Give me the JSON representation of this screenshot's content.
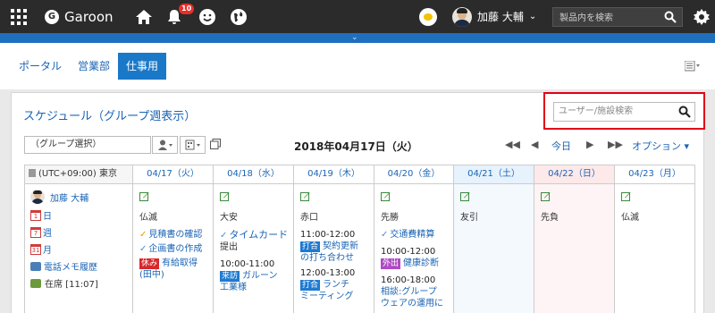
{
  "header": {
    "app_name": "Garoon",
    "logo_letter": "G",
    "notification_count": "10",
    "user_name": "加藤 大輔",
    "search_placeholder": "製品内を検索"
  },
  "tabs": [
    "ポータル",
    "営業部",
    "仕事用"
  ],
  "schedule": {
    "title": "スケジュール（グループ週表示）",
    "facility_search_placeholder": "ユーザー/施設検索",
    "group_select": "（グループ選択）",
    "current_date": "2018年04月17日（火）",
    "today_label": "今日",
    "option_label": "オプション",
    "timezone": "(UTC+09:00) 東京",
    "days": [
      {
        "label": "04/17（火）",
        "rokuyo": "仏滅"
      },
      {
        "label": "04/18（水）",
        "rokuyo": "大安"
      },
      {
        "label": "04/19（木）",
        "rokuyo": "赤口"
      },
      {
        "label": "04/20（金）",
        "rokuyo": "先勝"
      },
      {
        "label": "04/21（土）",
        "rokuyo": "友引"
      },
      {
        "label": "04/22（日）",
        "rokuyo": "先負"
      },
      {
        "label": "04/23（月）",
        "rokuyo": "仏滅"
      }
    ],
    "user": {
      "name": "加藤 大輔",
      "day_link": "日",
      "week_link": "週",
      "month_link": "月",
      "memo_link": "電話メモ履歴",
      "presence": "在席 [11:07]"
    },
    "events": {
      "d0": [
        "見積書の確認",
        "企画書の作成",
        "有給取得",
        "(田中)"
      ],
      "d0_tag": "休み",
      "d1_todo": "タイムカード",
      "d1_todo2": "提出",
      "d1_time": "10:00-11:00",
      "d1_tag": "来訪",
      "d1_event": "ガルーン",
      "d1_event2": "工業様",
      "d2_time1": "11:00-12:00",
      "d2_tag1": "打合",
      "d2_event1": "契約更新",
      "d2_event1b": "の打ち合わせ",
      "d2_time2": "12:00-13:00",
      "d2_tag2": "打合",
      "d2_event2": "ランチ",
      "d2_event2b": "ミーティング",
      "d3_todo": "交通費精算",
      "d3_time1": "10:00-12:00",
      "d3_tag1": "外出",
      "d3_event1": "健康診断",
      "d3_time2": "16:00-18:00",
      "d3_event2": "相談:グループ",
      "d3_event2b": "ウェアの運用に"
    }
  },
  "colors": {
    "topbar": "#2b2b2b",
    "accent_blue": "#1a78c8",
    "highlight_red": "#e0001a"
  }
}
